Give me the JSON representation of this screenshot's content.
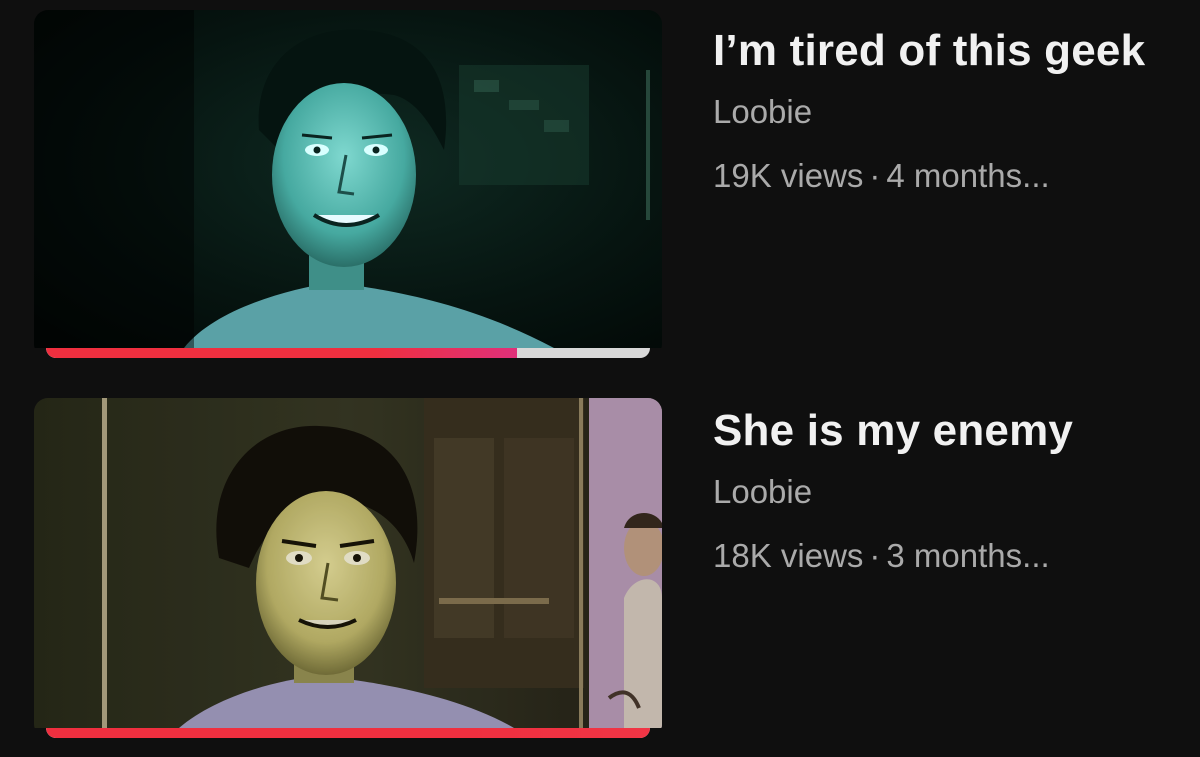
{
  "videos": [
    {
      "title": "I’m tired of this geek",
      "channel": "Loobie",
      "views": "19K views",
      "separator": "·",
      "age": "4 months...",
      "watch_progress": 0.78,
      "colors": {
        "progress_start": "#ef2f3f",
        "progress_end": "#e0307a"
      }
    },
    {
      "title": "She is my enemy",
      "channel": "Loobie",
      "views": "18K views",
      "separator": "·",
      "age": "3 months...",
      "watch_progress": 1.0,
      "colors": {
        "progress_start": "#ef2f3f",
        "progress_end": "#f03545"
      }
    }
  ]
}
